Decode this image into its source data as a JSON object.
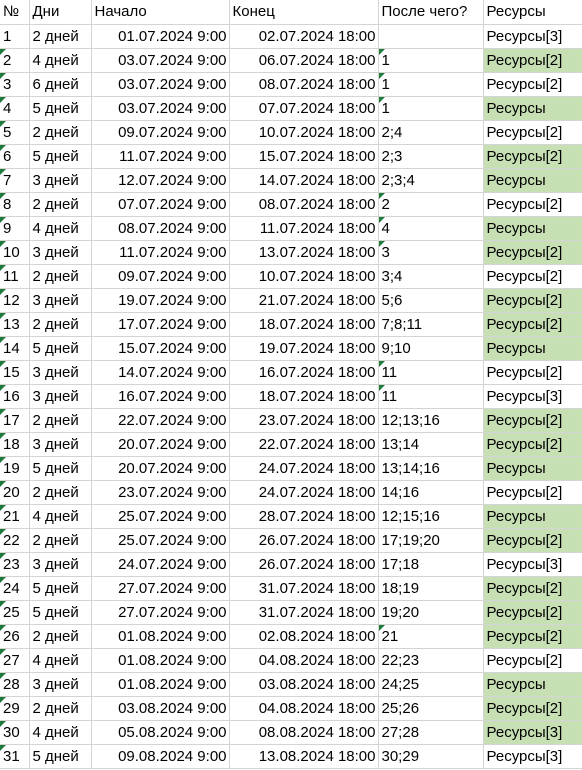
{
  "header": {
    "num": "№",
    "days": "Дни",
    "start": "Начало",
    "end": "Конец",
    "after": "После чего?",
    "resources": "Ресурсы"
  },
  "colors": {
    "green_fill": "#c6e0b4",
    "marker": "#1e7b3a",
    "grid": "#d4d4d4"
  },
  "rows": [
    {
      "num": "1",
      "days": "2 дней",
      "start": "01.07.2024 9:00",
      "end": "02.07.2024 18:00",
      "after": "",
      "res": "Ресурсы[3]",
      "green": false,
      "num_marker": false,
      "after_marker": false
    },
    {
      "num": "2",
      "days": "4 дней",
      "start": "03.07.2024 9:00",
      "end": "06.07.2024 18:00",
      "after": "1",
      "res": "Ресурсы[2]",
      "green": true,
      "num_marker": true,
      "after_marker": true
    },
    {
      "num": "3",
      "days": "6 дней",
      "start": "03.07.2024 9:00",
      "end": "08.07.2024 18:00",
      "after": "1",
      "res": "Ресурсы[2]",
      "green": false,
      "num_marker": true,
      "after_marker": true
    },
    {
      "num": "4",
      "days": "5 дней",
      "start": "03.07.2024 9:00",
      "end": "07.07.2024 18:00",
      "after": "1",
      "res": "Ресурсы",
      "green": true,
      "num_marker": true,
      "after_marker": true
    },
    {
      "num": "5",
      "days": "2 дней",
      "start": "09.07.2024 9:00",
      "end": "10.07.2024 18:00",
      "after": "2;4",
      "res": "Ресурсы[2]",
      "green": false,
      "num_marker": true,
      "after_marker": false
    },
    {
      "num": "6",
      "days": "5 дней",
      "start": "11.07.2024 9:00",
      "end": "15.07.2024 18:00",
      "after": "2;3",
      "res": "Ресурсы[2]",
      "green": true,
      "num_marker": true,
      "after_marker": false
    },
    {
      "num": "7",
      "days": "3 дней",
      "start": "12.07.2024 9:00",
      "end": "14.07.2024 18:00",
      "after": "2;3;4",
      "res": "Ресурсы",
      "green": true,
      "num_marker": true,
      "after_marker": false
    },
    {
      "num": "8",
      "days": "2 дней",
      "start": "07.07.2024 9:00",
      "end": "08.07.2024 18:00",
      "after": "2",
      "res": "Ресурсы[2]",
      "green": false,
      "num_marker": true,
      "after_marker": true
    },
    {
      "num": "9",
      "days": "4 дней",
      "start": "08.07.2024 9:00",
      "end": "11.07.2024 18:00",
      "after": "4",
      "res": "Ресурсы",
      "green": true,
      "num_marker": true,
      "after_marker": true
    },
    {
      "num": "10",
      "days": "3 дней",
      "start": "11.07.2024 9:00",
      "end": "13.07.2024 18:00",
      "after": "3",
      "res": "Ресурсы[2]",
      "green": true,
      "num_marker": true,
      "after_marker": true
    },
    {
      "num": "11",
      "days": "2 дней",
      "start": "09.07.2024 9:00",
      "end": "10.07.2024 18:00",
      "after": "3;4",
      "res": "Ресурсы[2]",
      "green": false,
      "num_marker": true,
      "after_marker": false
    },
    {
      "num": "12",
      "days": "3 дней",
      "start": "19.07.2024 9:00",
      "end": "21.07.2024 18:00",
      "after": "5;6",
      "res": "Ресурсы[2]",
      "green": true,
      "num_marker": true,
      "after_marker": false
    },
    {
      "num": "13",
      "days": "2 дней",
      "start": "17.07.2024 9:00",
      "end": "18.07.2024 18:00",
      "after": "7;8;11",
      "res": "Ресурсы[2]",
      "green": true,
      "num_marker": true,
      "after_marker": false
    },
    {
      "num": "14",
      "days": "5 дней",
      "start": "15.07.2024 9:00",
      "end": "19.07.2024 18:00",
      "after": "9;10",
      "res": "Ресурсы",
      "green": true,
      "num_marker": true,
      "after_marker": false
    },
    {
      "num": "15",
      "days": "3 дней",
      "start": "14.07.2024 9:00",
      "end": "16.07.2024 18:00",
      "after": "11",
      "res": "Ресурсы[2]",
      "green": false,
      "num_marker": true,
      "after_marker": true
    },
    {
      "num": "16",
      "days": "3 дней",
      "start": "16.07.2024 9:00",
      "end": "18.07.2024 18:00",
      "after": "11",
      "res": "Ресурсы[3]",
      "green": false,
      "num_marker": true,
      "after_marker": true
    },
    {
      "num": "17",
      "days": "2 дней",
      "start": "22.07.2024 9:00",
      "end": "23.07.2024 18:00",
      "after": "12;13;16",
      "res": "Ресурсы[2]",
      "green": true,
      "num_marker": true,
      "after_marker": false
    },
    {
      "num": "18",
      "days": "3 дней",
      "start": "20.07.2024 9:00",
      "end": "22.07.2024 18:00",
      "after": "13;14",
      "res": "Ресурсы[2]",
      "green": true,
      "num_marker": true,
      "after_marker": false
    },
    {
      "num": "19",
      "days": "5 дней",
      "start": "20.07.2024 9:00",
      "end": "24.07.2024 18:00",
      "after": "13;14;16",
      "res": "Ресурсы",
      "green": true,
      "num_marker": true,
      "after_marker": false
    },
    {
      "num": "20",
      "days": "2 дней",
      "start": "23.07.2024 9:00",
      "end": "24.07.2024 18:00",
      "after": "14;16",
      "res": "Ресурсы[2]",
      "green": false,
      "num_marker": true,
      "after_marker": false
    },
    {
      "num": "21",
      "days": "4 дней",
      "start": "25.07.2024 9:00",
      "end": "28.07.2024 18:00",
      "after": "12;15;16",
      "res": "Ресурсы",
      "green": true,
      "num_marker": true,
      "after_marker": false
    },
    {
      "num": "22",
      "days": "2 дней",
      "start": "25.07.2024 9:00",
      "end": "26.07.2024 18:00",
      "after": "17;19;20",
      "res": "Ресурсы[2]",
      "green": true,
      "num_marker": true,
      "after_marker": false
    },
    {
      "num": "23",
      "days": "3 дней",
      "start": "24.07.2024 9:00",
      "end": "26.07.2024 18:00",
      "after": "17;18",
      "res": "Ресурсы[3]",
      "green": false,
      "num_marker": true,
      "after_marker": false
    },
    {
      "num": "24",
      "days": "5 дней",
      "start": "27.07.2024 9:00",
      "end": "31.07.2024 18:00",
      "after": "18;19",
      "res": "Ресурсы[2]",
      "green": true,
      "num_marker": true,
      "after_marker": false
    },
    {
      "num": "25",
      "days": "5 дней",
      "start": "27.07.2024 9:00",
      "end": "31.07.2024 18:00",
      "after": "19;20",
      "res": "Ресурсы[2]",
      "green": true,
      "num_marker": true,
      "after_marker": false
    },
    {
      "num": "26",
      "days": "2 дней",
      "start": "01.08.2024 9:00",
      "end": "02.08.2024 18:00",
      "after": "21",
      "res": "Ресурсы[2]",
      "green": true,
      "num_marker": true,
      "after_marker": true
    },
    {
      "num": "27",
      "days": "4 дней",
      "start": "01.08.2024 9:00",
      "end": "04.08.2024 18:00",
      "after": "22;23",
      "res": "Ресурсы[2]",
      "green": false,
      "num_marker": true,
      "after_marker": false
    },
    {
      "num": "28",
      "days": "3 дней",
      "start": "01.08.2024 9:00",
      "end": "03.08.2024 18:00",
      "after": "24;25",
      "res": "Ресурсы",
      "green": true,
      "num_marker": true,
      "after_marker": false
    },
    {
      "num": "29",
      "days": "2 дней",
      "start": "03.08.2024 9:00",
      "end": "04.08.2024 18:00",
      "after": "25;26",
      "res": "Ресурсы[2]",
      "green": true,
      "num_marker": true,
      "after_marker": false
    },
    {
      "num": "30",
      "days": "4 дней",
      "start": "05.08.2024 9:00",
      "end": "08.08.2024 18:00",
      "after": "27;28",
      "res": "Ресурсы[3]",
      "green": true,
      "num_marker": true,
      "after_marker": false
    },
    {
      "num": "31",
      "days": "5 дней",
      "start": "09.08.2024 9:00",
      "end": "13.08.2024 18:00",
      "after": "30;29",
      "res": "Ресурсы[3]",
      "green": false,
      "num_marker": true,
      "after_marker": false
    }
  ]
}
